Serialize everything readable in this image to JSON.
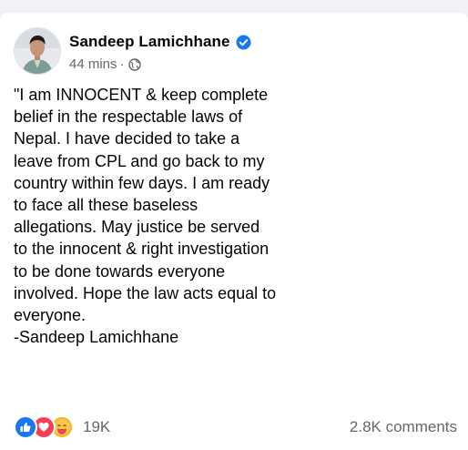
{
  "post": {
    "author": "Sandeep Lamichhane",
    "time": "44 mins",
    "separator": "·",
    "verified": true,
    "privacy_icon": "globe-icon",
    "text": "\"I am INNOCENT & keep complete belief in the respectable laws of Nepal. I have decided to take a leave from CPL and go back to my country within few days. I am ready to face all these baseless allegations. May justice be served to the innocent & right investigation to be done towards everyone involved. Hope the law acts equal to everyone.\n-Sandeep Lamichhane"
  },
  "footer": {
    "reaction_icons": [
      "like-icon",
      "love-icon",
      "care-icon"
    ],
    "reaction_count": "19K",
    "comments": "2.8K comments"
  },
  "colors": {
    "accent": "#1877f2",
    "love": "#f33e58",
    "care": "#f7b125",
    "secondary_text": "#65676b"
  }
}
